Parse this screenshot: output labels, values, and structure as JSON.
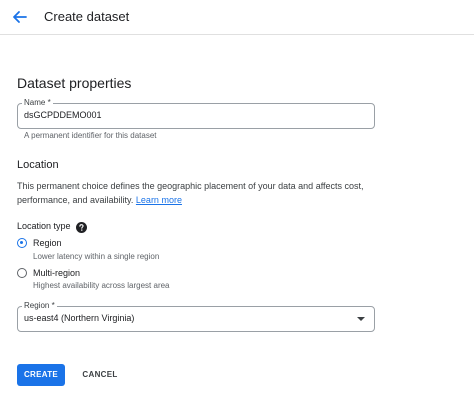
{
  "header": {
    "title": "Create dataset",
    "back_icon": "arrow-left-icon"
  },
  "properties": {
    "heading": "Dataset properties",
    "name_label": "Name *",
    "name_value": "dsGCPDDEMO001",
    "name_hint": "A permanent identifier for this dataset"
  },
  "location": {
    "heading": "Location",
    "description": "This permanent choice defines the geographic placement of your data and affects cost, performance, and availability.",
    "learn_more": "Learn more",
    "type_label": "Location type",
    "help_icon": "help-icon",
    "options": [
      {
        "label": "Region",
        "sub": "Lower latency within a single region",
        "selected": true
      },
      {
        "label": "Multi-region",
        "sub": "Highest availability across largest area",
        "selected": false
      }
    ],
    "region_label": "Region *",
    "region_value": "us-east4 (Northern Virginia)"
  },
  "actions": {
    "create": "CREATE",
    "cancel": "CANCEL"
  },
  "colors": {
    "accent": "#1a73e8",
    "text": "#202124",
    "secondary": "#5f6368"
  }
}
